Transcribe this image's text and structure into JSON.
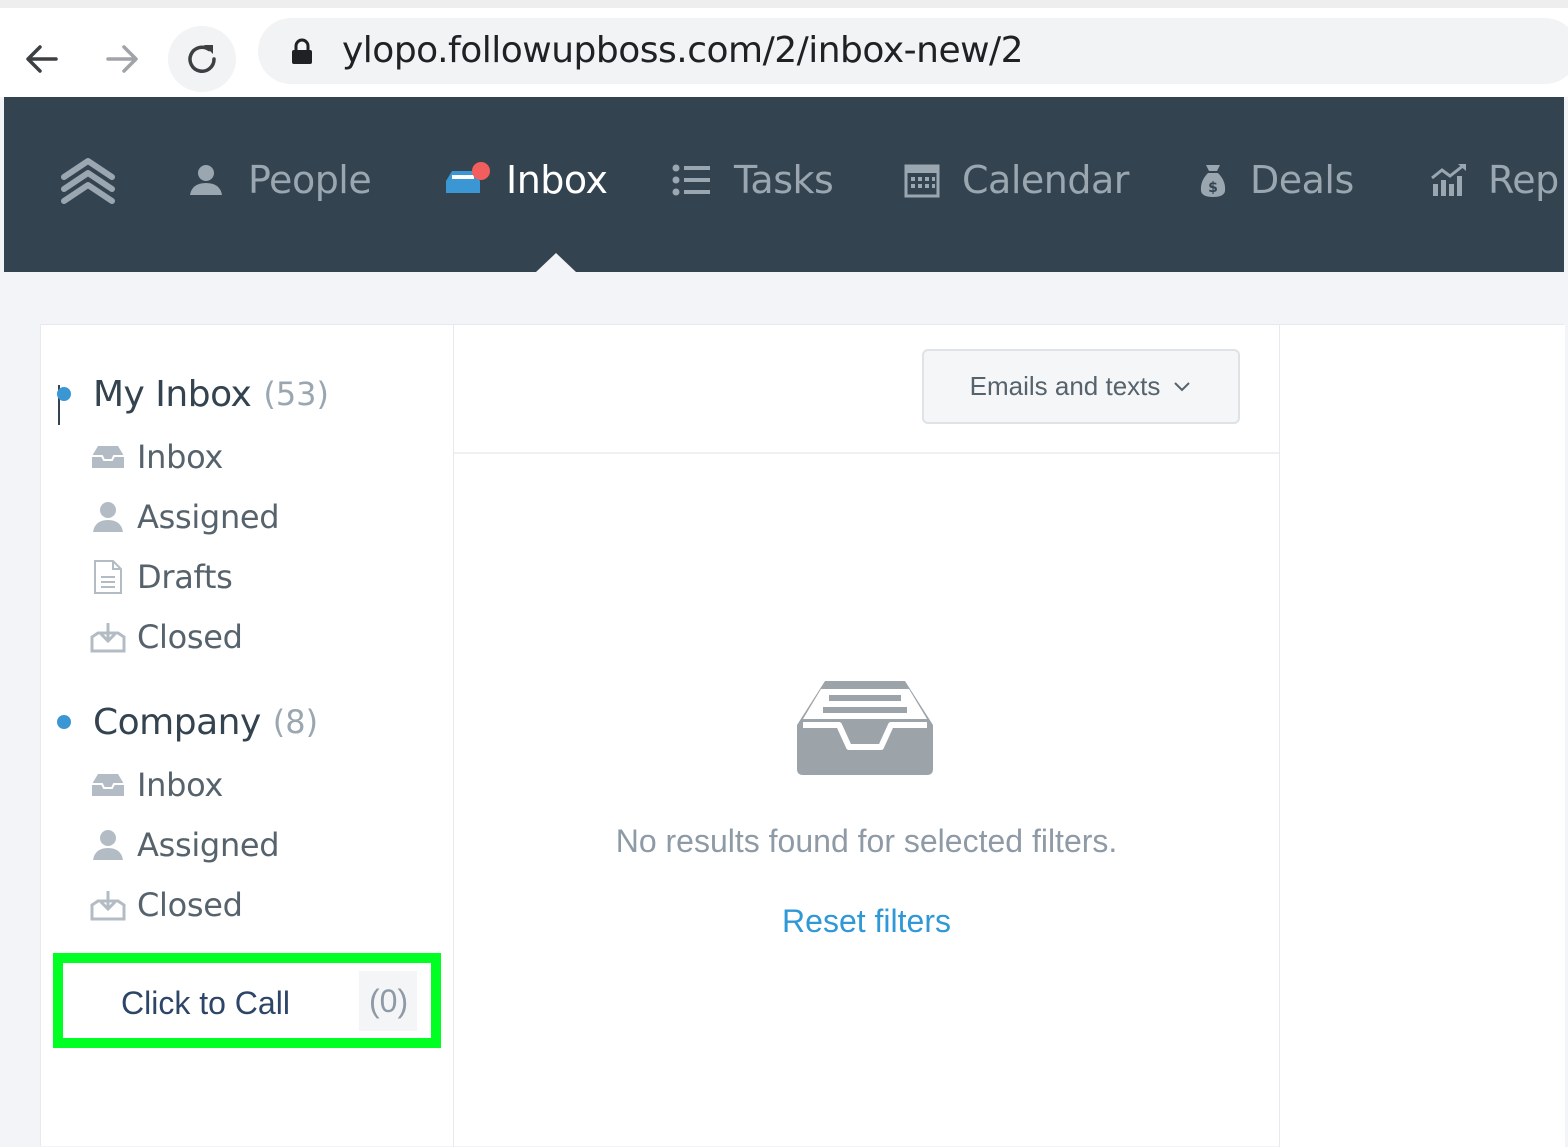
{
  "browser": {
    "url": "ylopo.followupboss.com/2/inbox-new/2"
  },
  "nav": {
    "items": [
      {
        "label": "People",
        "icon": "person-icon"
      },
      {
        "label": "Inbox",
        "icon": "inbox-icon",
        "active": true
      },
      {
        "label": "Tasks",
        "icon": "list-icon"
      },
      {
        "label": "Calendar",
        "icon": "calendar-icon"
      },
      {
        "label": "Deals",
        "icon": "money-bag-icon"
      },
      {
        "label": "Rep",
        "icon": "chart-icon"
      }
    ],
    "notification_color": "#f25d5d"
  },
  "sidebar": {
    "my_inbox": {
      "title": "My Inbox",
      "count": "(53)",
      "items": [
        {
          "label": "Inbox",
          "icon": "tray-icon"
        },
        {
          "label": "Assigned",
          "icon": "person-icon"
        },
        {
          "label": "Drafts",
          "icon": "document-icon"
        },
        {
          "label": "Closed",
          "icon": "download-tray-icon"
        }
      ]
    },
    "company": {
      "title": "Company",
      "count": "(8)",
      "items": [
        {
          "label": "Inbox",
          "icon": "tray-icon"
        },
        {
          "label": "Assigned",
          "icon": "person-icon"
        },
        {
          "label": "Closed",
          "icon": "download-tray-icon"
        }
      ]
    },
    "click_to_call": {
      "label": "Click to Call",
      "count": "(0)",
      "highlight_color": "#00ff22"
    }
  },
  "main": {
    "filter_label": "Emails and texts",
    "empty_message": "No results found for selected filters.",
    "reset_label": "Reset filters"
  },
  "colors": {
    "nav_bg": "#33434f",
    "accent": "#2f98d6",
    "dot": "#3a97d4"
  }
}
